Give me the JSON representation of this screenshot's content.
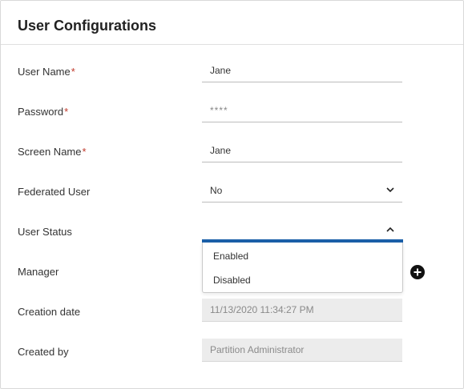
{
  "panel": {
    "title": "User Configurations"
  },
  "fields": {
    "user_name": {
      "label": "User Name",
      "required_mark": "*",
      "value": "Jane"
    },
    "password": {
      "label": "Password",
      "required_mark": "*",
      "value": "****"
    },
    "screen_name": {
      "label": "Screen Name",
      "required_mark": "*",
      "value": "Jane"
    },
    "federated_user": {
      "label": "Federated User",
      "value": "No",
      "icon": "chevron-down-icon"
    },
    "user_status": {
      "label": "User Status",
      "value": "",
      "icon": "chevron-up-icon",
      "options": [
        "Enabled",
        "Disabled"
      ],
      "accent_color": "#1a5fa8"
    },
    "manager": {
      "label": "Manager",
      "add_icon": "plus-circle-icon"
    },
    "creation_date": {
      "label": "Creation date",
      "value": "11/13/2020 11:34:27 PM"
    },
    "created_by": {
      "label": "Created by",
      "value": "Partition Administrator"
    }
  },
  "colors": {
    "required": "#c0392b",
    "readonly_bg": "#ececec"
  }
}
